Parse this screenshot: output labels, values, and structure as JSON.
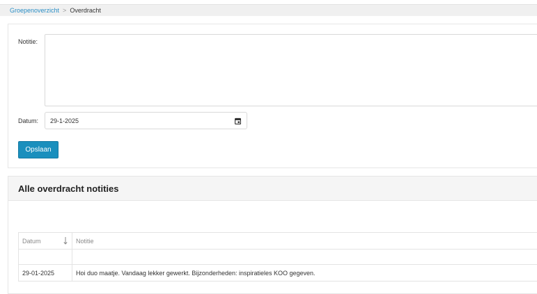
{
  "breadcrumb": {
    "parent": "Groepenoverzicht",
    "separator": ">",
    "current": "Overdracht"
  },
  "form": {
    "notitie_label": "Notitie:",
    "notitie_value": "",
    "datum_label": "Datum:",
    "datum_value": "29-1-2025",
    "calendar_icon": "calendar-icon",
    "save_label": "Opslaan"
  },
  "list": {
    "title": "Alle overdracht notities",
    "columns": [
      "Datum",
      "Notitie"
    ],
    "sort_icon": "sort-down-arrow-icon",
    "rows": [
      {
        "datum": "29-01-2025",
        "notitie": "Hoi duo maatje. Vandaag lekker gewerkt. Bijzonderheden: inspiratieles KOO gegeven."
      }
    ]
  },
  "colors": {
    "link": "#2b8fc6",
    "primary_button": "#1a8fbd",
    "header_bg": "#f5f5f5",
    "breadcrumb_bg": "#f0f0f0"
  }
}
